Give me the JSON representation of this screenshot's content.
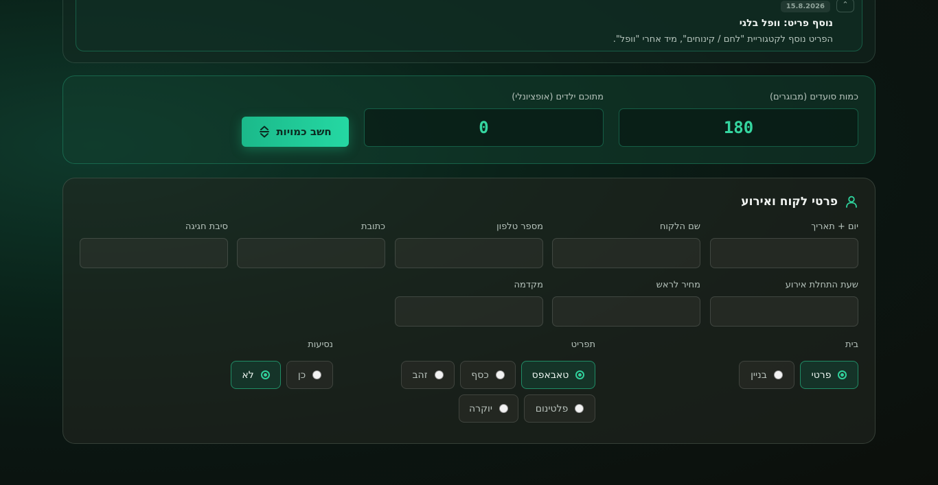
{
  "note": {
    "date": "15.8.2026",
    "collapse_icon": "chevron-up-icon",
    "title": "נוסף פריט: וופל בלגי",
    "text": "הפריט נוסף לקטגוריית \"לחם / קינוחים\", מיד אחרי \"וופל\"."
  },
  "quantity": {
    "adults_label": "כמות סועדים (מבוגרים)",
    "adults_value": "180",
    "kids_label": "מתוכם ילדים (אופציונלי)",
    "kids_value": "0",
    "calc_label": "חשב כמויות"
  },
  "customer": {
    "title": "פרטי לקוח ואירוע",
    "fields_row1": [
      "יום + תאריך",
      "שם הלקוח",
      "מספר טלפון",
      "כתובת",
      "סיבת חגיגה"
    ],
    "fields_row2": [
      "שעת התחלת אירוע",
      "מחיר לראש",
      "מקדמה"
    ],
    "house": {
      "label": "בית",
      "options": [
        {
          "label": "פרטי",
          "selected": true
        },
        {
          "label": "בניין",
          "selected": false
        }
      ]
    },
    "menu": {
      "label": "תפריט",
      "options": [
        {
          "label": "טאבאפס",
          "selected": true
        },
        {
          "label": "כסף",
          "selected": false
        },
        {
          "label": "זהב",
          "selected": false
        },
        {
          "label": "פלטינום",
          "selected": false
        },
        {
          "label": "יוקרה",
          "selected": false
        }
      ]
    },
    "travel": {
      "label": "נסיעות",
      "options": [
        {
          "label": "כן",
          "selected": false
        },
        {
          "label": "לא",
          "selected": true
        }
      ]
    }
  },
  "colors": {
    "accent": "#25d8a3",
    "accent_text": "#35d6a0"
  }
}
